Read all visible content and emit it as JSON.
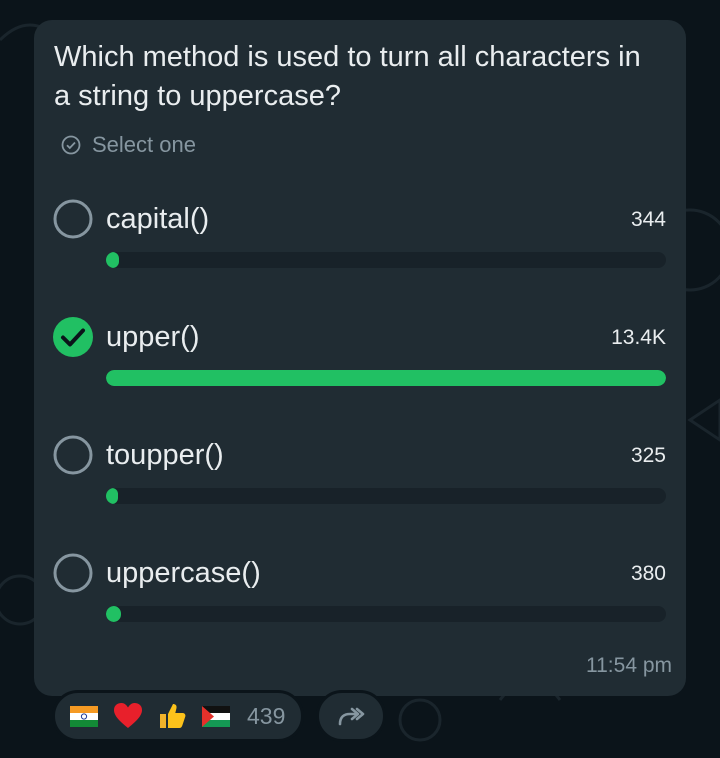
{
  "poll": {
    "question": "Which method is used to turn all characters in a string to uppercase?",
    "hint": "Select one",
    "options": [
      {
        "label": "capital()",
        "count": "344",
        "fraction": 0.023,
        "selected": false
      },
      {
        "label": "upper()",
        "count": "13.4K",
        "fraction": 1.0,
        "selected": true
      },
      {
        "label": "toupper()",
        "count": "325",
        "fraction": 0.022,
        "selected": false
      },
      {
        "label": "uppercase()",
        "count": "380",
        "fraction": 0.026,
        "selected": false
      }
    ],
    "time": "11:54 pm"
  },
  "reactions": {
    "emojis": [
      "india-flag",
      "red-heart",
      "thumbs-up",
      "palestine-flag"
    ],
    "count": "439"
  },
  "colors": {
    "accent": "#21c063",
    "bubble": "#202c33",
    "background": "#0b141a",
    "text": "#e9edef",
    "muted": "#8696a0"
  }
}
